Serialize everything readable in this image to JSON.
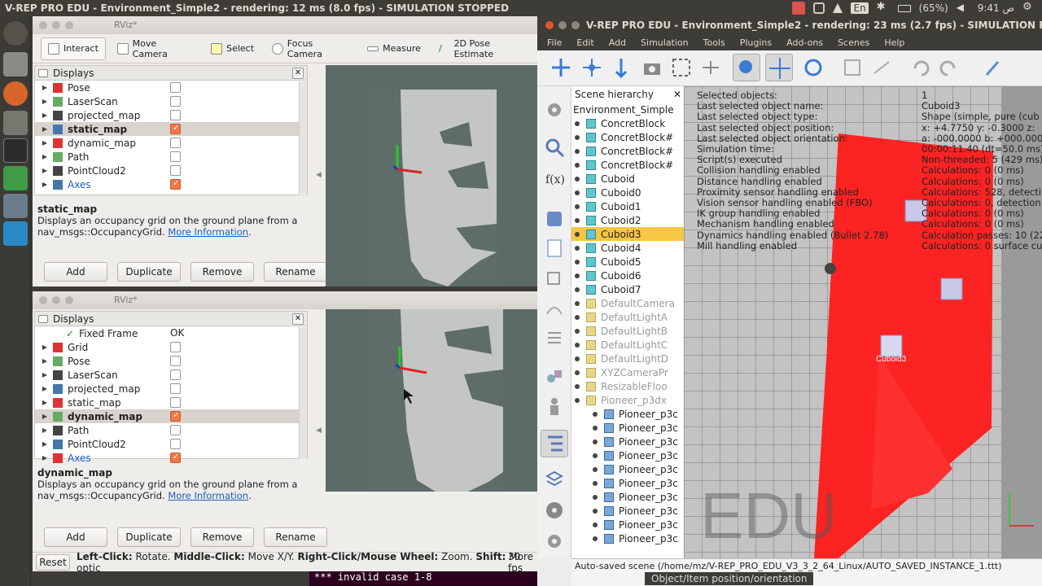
{
  "topbar": {
    "title": "V-REP PRO EDU - Environment_Simple2 - rendering: 12 ms (8.0 fps) - SIMULATION STOPPED",
    "lang": "En",
    "battery": "(65%)",
    "clock": "9:41 ص"
  },
  "rviz1": {
    "title": "RViz*",
    "tools": [
      "Interact",
      "Move Camera",
      "Select",
      "Focus Camera",
      "Measure",
      "2D Pose Estimate"
    ],
    "displays_label": "Displays",
    "items": [
      {
        "label": "Pose",
        "checked": false
      },
      {
        "label": "LaserScan",
        "checked": false
      },
      {
        "label": "projected_map",
        "checked": false
      },
      {
        "label": "static_map",
        "checked": true,
        "selected": true
      },
      {
        "label": "dynamic_map",
        "checked": false
      },
      {
        "label": "Path",
        "checked": false
      },
      {
        "label": "PointCloud2",
        "checked": false
      },
      {
        "label": "Axes",
        "checked": true
      }
    ],
    "desc_title": "static_map",
    "desc_text": "Displays an occupancy grid on the ground plane from a nav_msgs::OccupancyGrid.",
    "desc_link": "More Information",
    "buttons": [
      "Add",
      "Duplicate",
      "Remove",
      "Rename"
    ]
  },
  "rviz2": {
    "title": "RViz*",
    "displays_label": "Displays",
    "fixed_frame": "Fixed Frame",
    "fixed_frame_val": "OK",
    "items": [
      {
        "label": "Grid",
        "checked": false
      },
      {
        "label": "Pose",
        "checked": false
      },
      {
        "label": "LaserScan",
        "checked": false
      },
      {
        "label": "projected_map",
        "checked": false
      },
      {
        "label": "static_map",
        "checked": false
      },
      {
        "label": "dynamic_map",
        "checked": true,
        "selected": true
      },
      {
        "label": "Path",
        "checked": false
      },
      {
        "label": "PointCloud2",
        "checked": false
      },
      {
        "label": "Axes",
        "checked": true
      }
    ],
    "desc_title": "dynamic_map",
    "desc_text": "Displays an occupancy grid on the ground plane from a nav_msgs::OccupancyGrid.",
    "desc_link": "More Information",
    "buttons": [
      "Add",
      "Duplicate",
      "Remove",
      "Rename"
    ]
  },
  "bottom": {
    "reset": "Reset",
    "hint_left": "Left-Click:",
    "hint_left_v": "Rotate.",
    "hint_mid": "Middle-Click:",
    "hint_mid_v": "Move X/Y.",
    "hint_right": "Right-Click/Mouse Wheel:",
    "hint_right_v": "Zoom.",
    "hint_shift": "Shift:",
    "hint_shift_v": "More optic",
    "fps": "30 fps"
  },
  "terminal": {
    "text": "*** invalid case 1-8"
  },
  "vrep": {
    "title": "V-REP PRO EDU - Environment_Simple2 - rendering: 23 ms (2.7 fps) - SIMULATION RUNNING",
    "menu": [
      "File",
      "Edit",
      "Add",
      "Simulation",
      "Tools",
      "Plugins",
      "Add-ons",
      "Scenes",
      "Help"
    ],
    "hier_title": "Scene hierarchy",
    "hier_root": "Environment_Simple",
    "hier": [
      {
        "label": "ConcretBlock",
        "type": "cube"
      },
      {
        "label": "ConcretBlock#",
        "type": "cube"
      },
      {
        "label": "ConcretBlock#",
        "type": "cube"
      },
      {
        "label": "ConcretBlock#",
        "type": "cube"
      },
      {
        "label": "Cuboid",
        "type": "cube"
      },
      {
        "label": "Cuboid0",
        "type": "cube"
      },
      {
        "label": "Cuboid1",
        "type": "cube"
      },
      {
        "label": "Cuboid2",
        "type": "cube"
      },
      {
        "label": "Cuboid3",
        "type": "cube",
        "selected": true
      },
      {
        "label": "Cuboid4",
        "type": "cube"
      },
      {
        "label": "Cuboid5",
        "type": "cube"
      },
      {
        "label": "Cuboid6",
        "type": "cube"
      },
      {
        "label": "Cuboid7",
        "type": "cube"
      },
      {
        "label": "DefaultCamera",
        "type": "dim"
      },
      {
        "label": "DefaultLightA",
        "type": "dim"
      },
      {
        "label": "DefaultLightB",
        "type": "dim"
      },
      {
        "label": "DefaultLightC",
        "type": "dim"
      },
      {
        "label": "DefaultLightD",
        "type": "dim"
      },
      {
        "label": "XYZCameraPr",
        "type": "dim"
      },
      {
        "label": "ResizableFloo",
        "type": "dim"
      },
      {
        "label": "Pioneer_p3dx",
        "type": "dim"
      },
      {
        "label": "Pioneer_p3c",
        "type": "child"
      },
      {
        "label": "Pioneer_p3c",
        "type": "child"
      },
      {
        "label": "Pioneer_p3c",
        "type": "child"
      },
      {
        "label": "Pioneer_p3c",
        "type": "child"
      },
      {
        "label": "Pioneer_p3c",
        "type": "child"
      },
      {
        "label": "Pioneer_p3c",
        "type": "child"
      },
      {
        "label": "Pioneer_p3c",
        "type": "child"
      },
      {
        "label": "Pioneer_p3c",
        "type": "child"
      },
      {
        "label": "Pioneer_p3c",
        "type": "child"
      },
      {
        "label": "Pioneer_p3c",
        "type": "child"
      }
    ],
    "info_left": [
      "Selected objects:",
      "Last selected object name:",
      "Last selected object type:",
      "Last selected object position:",
      "Last selected object orientation:",
      "Simulation time:",
      "Script(s) executed",
      "Collision handling enabled",
      "Distance handling enabled",
      "Proximity sensor handling enabled",
      "Vision sensor handling enabled (FBO)",
      "IK group handling enabled",
      "Mechanism handling enabled",
      "Dynamics handling enabled (Bullet 2.78)",
      "Mill handling enabled"
    ],
    "info_right": [
      "1",
      "Cuboid3",
      "Shape (simple, pure (cub",
      "x: +4.7750   y: -0.3000   z:",
      "a: -000.0000   b: +000.000",
      "00:00:11.40 (dt=50.0 ms)",
      "Non-threaded: 5 (429 ms)",
      "Calculations: 0 (0 ms)",
      "Calculations: 0 (0 ms)",
      "Calculations: 528, detecti",
      "Calculations: 0, detection",
      "Calculations: 0 (0 ms)",
      "Calculations: 0 (0 ms)",
      "Calculation passes: 10 (22",
      "Calculations: 0 surface cu"
    ],
    "object_label": "Cuboid3",
    "watermark": "EDU",
    "status1": "Auto-saved scene (/home/mz/V-REP_PRO_EDU_V3_3_2_64_Linux/AUTO_SAVED_INSTANCE_1.ttt)",
    "status2": "Object/Item position/orientation"
  }
}
